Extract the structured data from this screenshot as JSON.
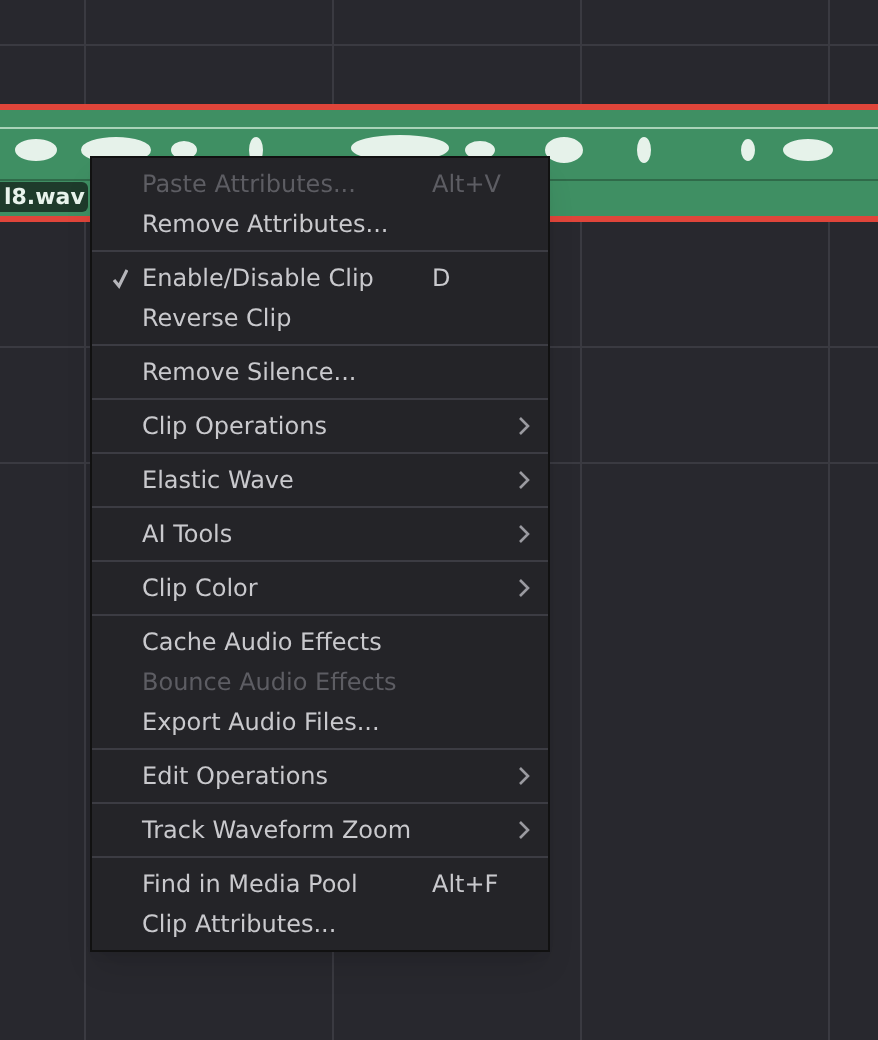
{
  "clip": {
    "name": "l8.wav"
  },
  "menu": {
    "sections": [
      {
        "items": [
          {
            "label": "Paste Attributes...",
            "shortcut": "Alt+V",
            "disabled": true,
            "checked": false,
            "submenu": false
          },
          {
            "label": "Remove Attributes...",
            "disabled": false,
            "checked": false,
            "submenu": false
          }
        ]
      },
      {
        "items": [
          {
            "label": "Enable/Disable Clip",
            "shortcut": "D",
            "disabled": false,
            "checked": true,
            "submenu": false
          },
          {
            "label": "Reverse Clip",
            "disabled": false,
            "checked": false,
            "submenu": false
          }
        ]
      },
      {
        "items": [
          {
            "label": "Remove Silence...",
            "disabled": false,
            "checked": false,
            "submenu": false
          }
        ]
      },
      {
        "items": [
          {
            "label": "Clip Operations",
            "disabled": false,
            "checked": false,
            "submenu": true
          }
        ]
      },
      {
        "items": [
          {
            "label": "Elastic Wave",
            "disabled": false,
            "checked": false,
            "submenu": true
          }
        ]
      },
      {
        "items": [
          {
            "label": "AI Tools",
            "disabled": false,
            "checked": false,
            "submenu": true
          }
        ]
      },
      {
        "items": [
          {
            "label": "Clip Color",
            "disabled": false,
            "checked": false,
            "submenu": true
          }
        ]
      },
      {
        "items": [
          {
            "label": "Cache Audio Effects",
            "disabled": false,
            "checked": false,
            "submenu": false
          },
          {
            "label": "Bounce Audio Effects",
            "disabled": true,
            "checked": false,
            "submenu": false
          },
          {
            "label": "Export Audio Files...",
            "disabled": false,
            "checked": false,
            "submenu": false
          }
        ]
      },
      {
        "items": [
          {
            "label": "Edit Operations",
            "disabled": false,
            "checked": false,
            "submenu": true
          }
        ]
      },
      {
        "items": [
          {
            "label": "Track Waveform Zoom",
            "disabled": false,
            "checked": false,
            "submenu": true
          }
        ]
      },
      {
        "items": [
          {
            "label": "Find in Media Pool",
            "shortcut": "Alt+F",
            "disabled": false,
            "checked": false,
            "submenu": false
          },
          {
            "label": "Clip Attributes...",
            "disabled": false,
            "checked": false,
            "submenu": false
          }
        ]
      }
    ]
  }
}
